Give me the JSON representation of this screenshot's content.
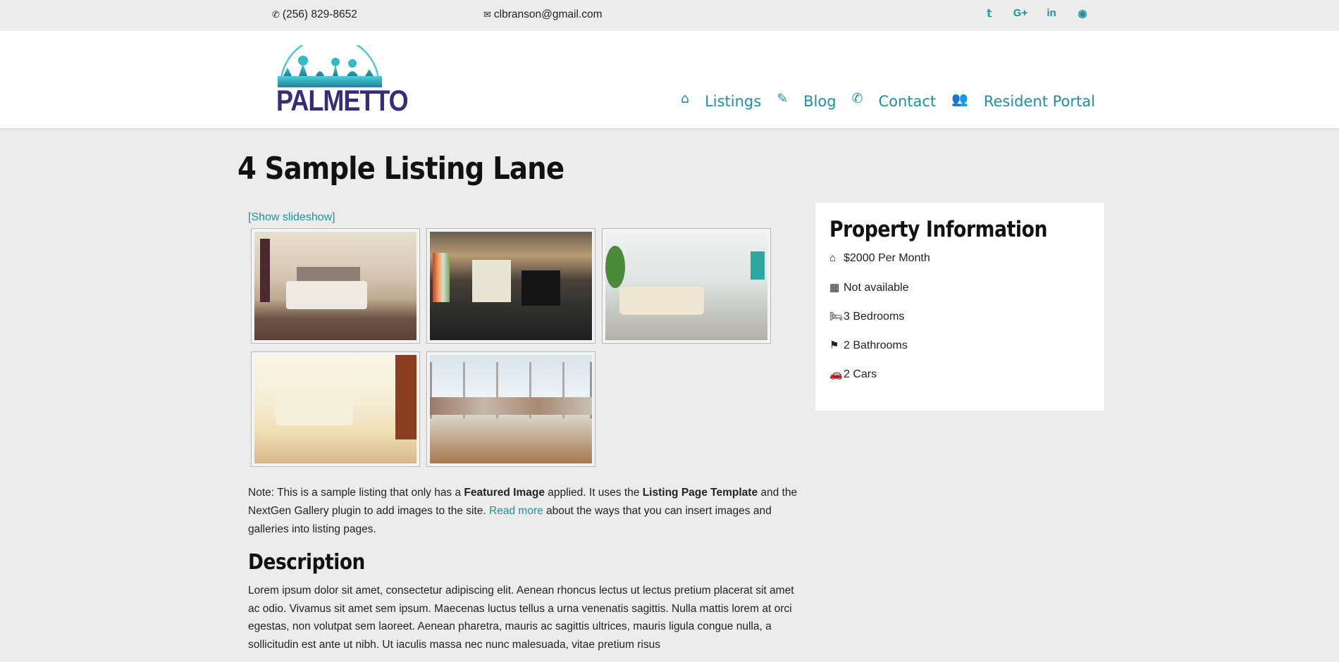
{
  "topbar": {
    "phone_icon": "phone-icon",
    "phone": "(256) 829-8652",
    "email_icon": "envelope-icon",
    "email": "clbranson@gmail.com",
    "social": [
      {
        "icon": "twitter-icon",
        "glyph": "𝕥"
      },
      {
        "icon": "google-plus-icon",
        "glyph": "G+"
      },
      {
        "icon": "linkedin-icon",
        "glyph": "in"
      },
      {
        "icon": "github-icon",
        "glyph": "◉"
      }
    ]
  },
  "header": {
    "logo_text": "PALMETTO",
    "nav": [
      {
        "icon": "home-icon",
        "glyph": "⌂",
        "label": "Listings"
      },
      {
        "icon": "pencil-icon",
        "glyph": "✎",
        "label": "Blog"
      },
      {
        "icon": "phone-icon",
        "glyph": "✆",
        "label": "Contact"
      },
      {
        "icon": "users-icon",
        "glyph": "👥",
        "label": "Resident Portal"
      }
    ]
  },
  "page": {
    "title": "4 Sample Listing Lane",
    "show_slideshow": "[Show slideshow]",
    "note": {
      "t1": "Note: This is a sample listing that only has a ",
      "b1": "Featured Image",
      "t2": " applied. It uses the ",
      "b2": "Listing Page Template",
      "t3": " and the NextGen Gallery plugin to add images to the site. ",
      "link": "Read more",
      "t4": " about the ways that you can insert images and galleries into listing pages."
    },
    "description_heading": "Description",
    "description": "Lorem ipsum dolor sit amet, consectetur adipiscing elit. Aenean rhoncus lectus ut lectus pretium placerat sit amet ac odio. Vivamus sit amet sem ipsum. Maecenas luctus tellus a urna venenatis sagittis. Nulla mattis lorem at orci egestas, non volutpat sem laoreet. Aenean pharetra, mauris ac sagittis ultrices, mauris ligula congue nulla, a sollicitudin est ante ut nibh. Ut iaculis massa nec nunc malesuada, vitae pretium risus"
  },
  "property": {
    "title": "Property Information",
    "rows": [
      {
        "icon": "home-icon",
        "glyph": "⌂",
        "text": "$2000 Per Month"
      },
      {
        "icon": "calendar-icon",
        "glyph": "▦",
        "text": "Not available"
      },
      {
        "icon": "bed-icon",
        "glyph": "🛏",
        "text": "3 Bedrooms"
      },
      {
        "icon": "shower-icon",
        "glyph": "⚑",
        "text": "2 Bathrooms"
      },
      {
        "icon": "car-icon",
        "glyph": "🚗",
        "text": "2 Cars"
      }
    ]
  }
}
